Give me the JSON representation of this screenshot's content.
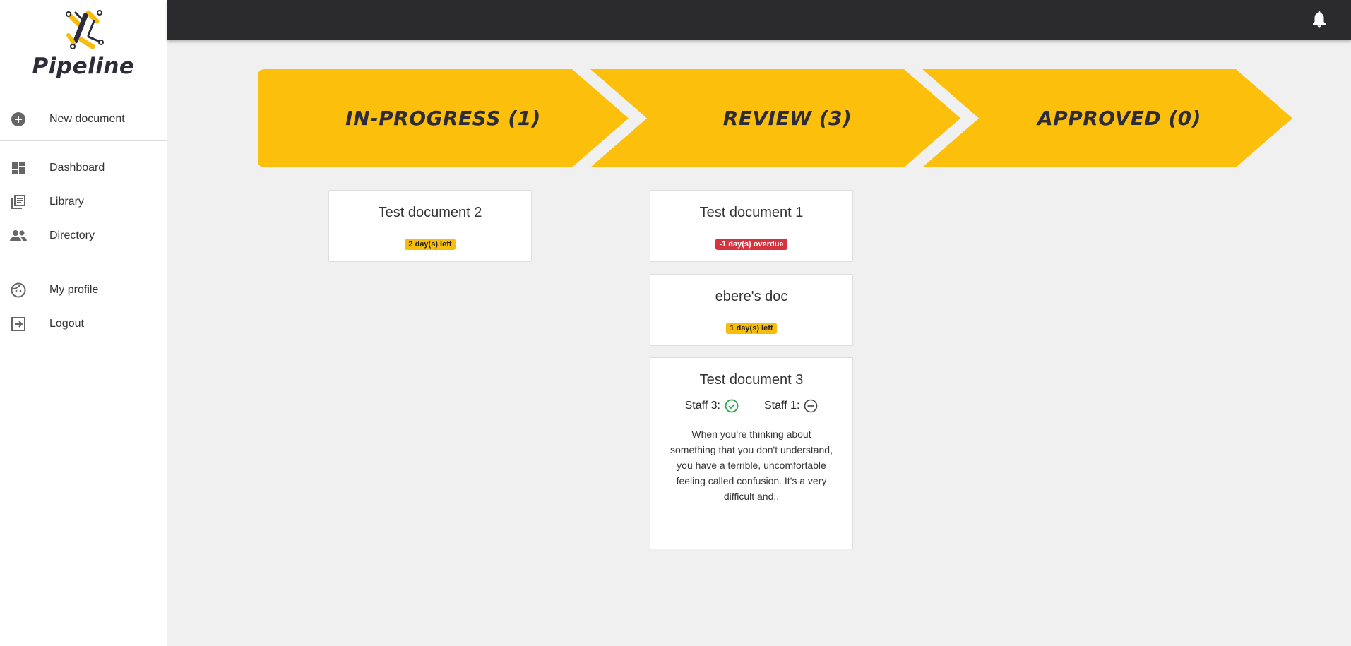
{
  "app": {
    "name": "Pipeline"
  },
  "sidebar": {
    "new_document": {
      "label": "New document",
      "icon": "add-circle-icon"
    },
    "nav": [
      {
        "label": "Dashboard",
        "icon": "dashboard-icon"
      },
      {
        "label": "Library",
        "icon": "library-icon"
      },
      {
        "label": "Directory",
        "icon": "people-icon"
      }
    ],
    "account": [
      {
        "label": "My profile",
        "icon": "face-icon"
      },
      {
        "label": "Logout",
        "icon": "logout-icon"
      }
    ]
  },
  "topbar": {
    "notifications_icon": "bell-icon"
  },
  "colors": {
    "accent": "#fcbf0c",
    "topbar": "#2b2b2d",
    "danger": "#d6323f",
    "success": "#28a745"
  },
  "stages": [
    {
      "label": "IN-PROGRESS (1)"
    },
    {
      "label": "REVIEW (3)"
    },
    {
      "label": "APPROVED (0)"
    }
  ],
  "cards": {
    "in_progress": [
      {
        "title": "Test document 2",
        "badge": "2 day(s) left",
        "badge_type": "warning"
      }
    ],
    "review": [
      {
        "title": "Test document 1",
        "badge": "-1 day(s) overdue",
        "badge_type": "danger"
      },
      {
        "title": "ebere's doc",
        "badge": "1 day(s) left",
        "badge_type": "warning"
      },
      {
        "title": "Test document 3",
        "reviewers": [
          {
            "label": "Staff 3:",
            "status": "approved",
            "icon": "check-circle-icon"
          },
          {
            "label": "Staff 1:",
            "status": "pending",
            "icon": "minus-circle-icon"
          }
        ],
        "excerpt": "When you're thinking about something that you don't understand, you have a terrible, uncomfortable feeling called confusion. It's a very difficult and.."
      }
    ]
  }
}
